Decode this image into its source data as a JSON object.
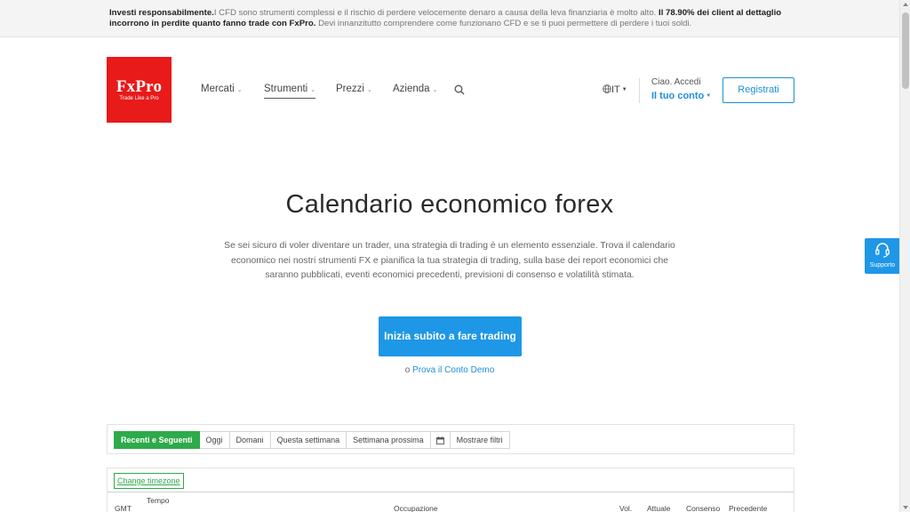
{
  "risk_banner": {
    "bold_lead": "Investi responsabilmente.",
    "text_1": "I CFD sono strumenti complessi e il rischio di perdere velocemente denaro a causa della leva finanziaria è molto alto.",
    "bold_stat": "Il 78.90% dei client al dettaglio incorrono in perdite quanto fanno trade con FxPro.",
    "text_2": "Devi innanzitutto comprendere come funzionano CFD e se ti puoi permettere di perdere i tuoi soldi."
  },
  "header": {
    "logo": {
      "name": "FxPro",
      "tagline": "Trade Like a Pro"
    },
    "nav": [
      {
        "label": "Mercati"
      },
      {
        "label": "Strumenti"
      },
      {
        "label": "Prezzi"
      },
      {
        "label": "Azienda"
      }
    ],
    "language": "IT",
    "greeting": "Ciao. Accedi",
    "account": "Il tuo conto",
    "register": "Registrati"
  },
  "hero": {
    "title": "Calendario economico forex",
    "subtitle": "Se sei sicuro di voler diventare un trader, una strategia di trading è un elemento essenziale. Trova il calendario economico nei nostri strumenti FX e pianifica la tua strategia di trading, sulla base dei report economici che saranno pubblicati, eventi economici precedenti, previsioni di consenso e volatilità stimata.",
    "cta": "Inizia subito a fare trading",
    "demo_prefix": "o",
    "demo_link": "Prova il Conto Demo"
  },
  "support": {
    "label": "Supporto"
  },
  "filters": {
    "buttons": [
      {
        "label": "Recenti e Seguenti",
        "active": true
      },
      {
        "label": "Oggi"
      },
      {
        "label": "Domani"
      },
      {
        "label": "Questa settimana"
      },
      {
        "label": "Settimana prossima"
      }
    ],
    "more_filters": "Mostrare filtri"
  },
  "table": {
    "timezone_button": "Change timezone",
    "headers": {
      "gmt": "GMT",
      "time": "Tempo",
      "event": "Occupazione",
      "vol": "Vol.",
      "actual": "Attuale",
      "consensus": "Consenso",
      "previous": "Precedente"
    }
  },
  "colors": {
    "brand_red": "#e81a1a",
    "accent_blue": "#1e97e6",
    "active_green": "#2eaa4a"
  }
}
